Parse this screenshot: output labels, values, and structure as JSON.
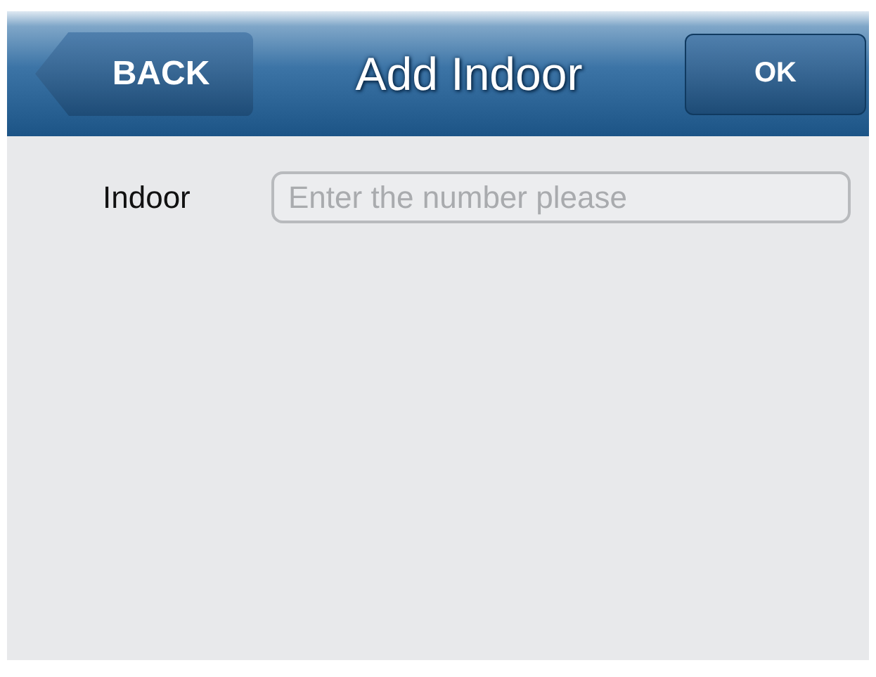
{
  "nav_bar": {
    "back_button": "BACK",
    "title": "Add Indoor",
    "ok_button": "OK"
  },
  "form": {
    "fields": [
      {
        "label": "Indoor",
        "placeholder": "Enter the number please"
      }
    ]
  }
}
